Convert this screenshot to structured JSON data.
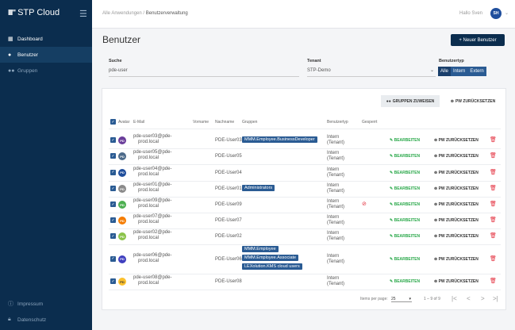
{
  "app": {
    "brand_logo": "III\"",
    "brand_name": "STP Cloud",
    "menu_icon": "hamburger-icon"
  },
  "sidebar": {
    "items": [
      {
        "label": "Dashboard",
        "icon": "dashboard-icon"
      },
      {
        "label": "Benutzer",
        "icon": "user-icon"
      },
      {
        "label": "Gruppen",
        "icon": "users-icon"
      }
    ],
    "footer": [
      {
        "label": "Impressum",
        "icon": "info-icon"
      },
      {
        "label": "Datenschutz",
        "icon": "lock-icon"
      }
    ]
  },
  "header": {
    "breadcrumb_root": "Alle Anwendungen",
    "breadcrumb_sep": "/",
    "breadcrumb_current": "Benutzerverwaltung",
    "greeting": "Hallo Sven",
    "avatar_initials": "SH"
  },
  "page": {
    "title": "Benutzer",
    "new_user_button": "+ Neuer Benutzer"
  },
  "filters": {
    "search_label": "Suche",
    "search_value": "pde-user",
    "tenant_label": "Tenant",
    "tenant_value": "STP-Demo",
    "type_label": "Benutzertyp",
    "type_options": [
      "Alle",
      "Intern",
      "Extern"
    ],
    "type_selected": "Alle"
  },
  "toolbar": {
    "assign_groups": "GRUPPEN ZUWEISEN",
    "reset_pw": "PW ZURÜCKSETZEN"
  },
  "table": {
    "columns": [
      "Avatar",
      "E-Mail",
      "Vorname",
      "Nachname",
      "Gruppen",
      "Benutzertyp",
      "Gesperrt"
    ],
    "edit_label": "BEARBEITEN",
    "reset_label": "PW ZURÜCKSETZEN",
    "rows": [
      {
        "initials": "PD",
        "avatar_color": "#6a3d9a",
        "email1": "pde-user03@pde-",
        "email2": "prod.local",
        "lastname": "PDE-User03",
        "groups": [
          "MMM.Employee.BusinessDeveloper"
        ],
        "type1": "Intern",
        "type2": "(Tenant)",
        "blocked": false
      },
      {
        "initials": "PD",
        "avatar_color": "#4d6b8a",
        "email1": "pde-user05@pde-",
        "email2": "prod.local",
        "lastname": "PDE-User05",
        "groups": [],
        "type1": "Intern",
        "type2": "(Tenant)",
        "blocked": false
      },
      {
        "initials": "PD",
        "avatar_color": "#1f4e9c",
        "email1": "pde-user04@pde-",
        "email2": "prod.local",
        "lastname": "PDE-User04",
        "groups": [],
        "type1": "Intern",
        "type2": "(Tenant)",
        "blocked": false
      },
      {
        "initials": "PD",
        "avatar_color": "#8a8a8a",
        "email1": "pde-user01@pde-",
        "email2": "prod.local",
        "lastname": "PDE-User01",
        "groups": [
          "Administrators"
        ],
        "type1": "Intern",
        "type2": "(Tenant)",
        "blocked": false
      },
      {
        "initials": "PD",
        "avatar_color": "#4caf50",
        "email1": "pde-user09@pde-",
        "email2": "prod.local",
        "lastname": "PDE-User09",
        "groups": [],
        "type1": "Intern",
        "type2": "(Tenant)",
        "blocked": true
      },
      {
        "initials": "PD",
        "avatar_color": "#f57c00",
        "email1": "pde-user07@pde-",
        "email2": "prod.local",
        "lastname": "PDE-User07",
        "groups": [],
        "type1": "Intern",
        "type2": "(Tenant)",
        "blocked": false
      },
      {
        "initials": "PD",
        "avatar_color": "#8bc34a",
        "email1": "pde-user02@pde-",
        "email2": "prod.local",
        "lastname": "PDE-User02",
        "groups": [],
        "type1": "Intern",
        "type2": "(Tenant)",
        "blocked": false
      },
      {
        "initials": "PD",
        "avatar_color": "#3f3fbf",
        "email1": "pde-user06@pde-",
        "email2": "prod.local",
        "lastname": "PDE-User06",
        "groups": [
          "MMM.Employee",
          "MMM.Employee.Associate",
          "LEXolution.KMS cloud users"
        ],
        "type1": "Intern",
        "type2": "(Tenant)",
        "blocked": false
      },
      {
        "initials": "PD",
        "avatar_color": "#fbc02d",
        "email1": "pde-user08@pde-",
        "email2": "prod.local",
        "lastname": "PDE-User08",
        "groups": [],
        "type1": "Intern",
        "type2": "(Tenant)",
        "blocked": false
      }
    ]
  },
  "pagination": {
    "items_label": "Items per page:",
    "per_page": "25",
    "range": "1 – 9 of 9"
  }
}
